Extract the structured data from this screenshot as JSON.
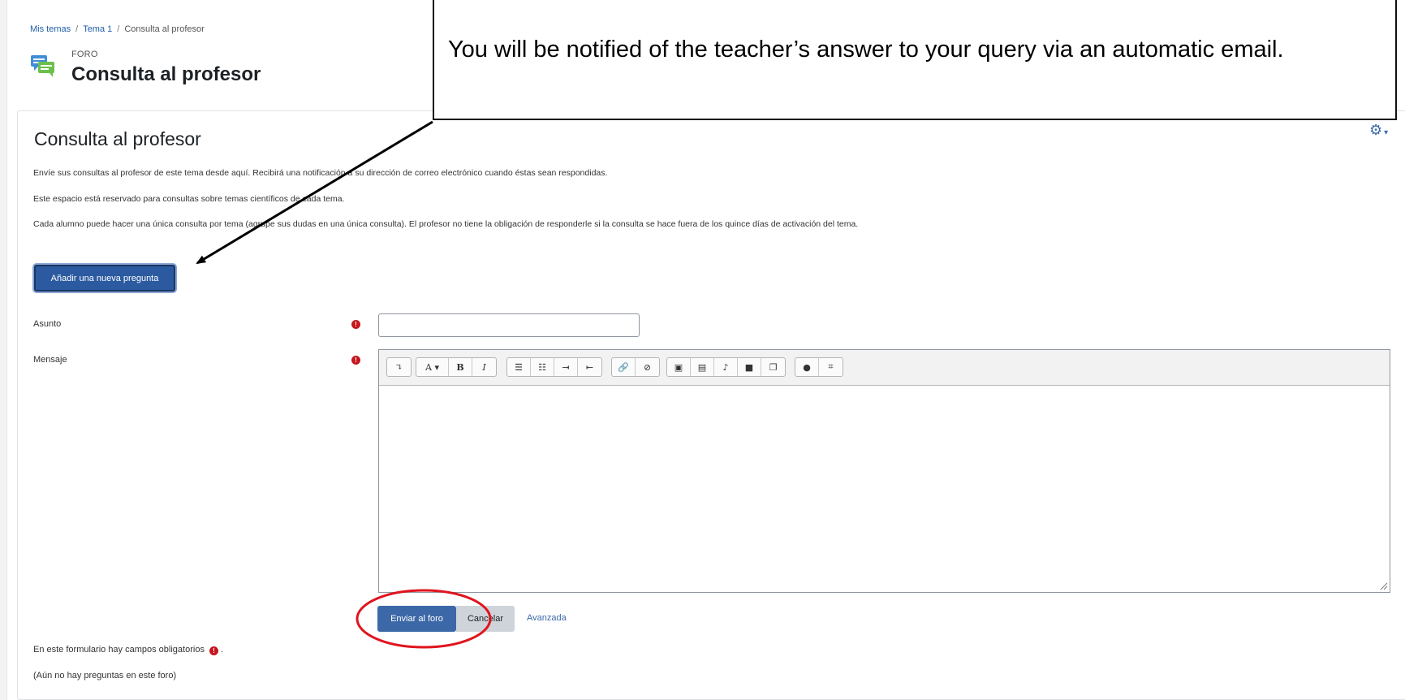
{
  "breadcrumb": {
    "items": [
      "Mis temas",
      "Tema 1",
      "Consulta al profesor"
    ],
    "separator": "/"
  },
  "header": {
    "module_type": "FORO",
    "title": "Consulta al profesor",
    "icon": "forum-icon"
  },
  "main": {
    "section_title": "Consulta al profesor",
    "intro": [
      "Envíe sus consultas al profesor de este tema desde aquí. Recibirá una notificación a su dirección de correo electrónico cuando éstas sean respondidas.",
      "Este espacio está reservado para consultas sobre temas científicos de cada tema.",
      "Cada alumno puede hacer una única consulta por tema (agrupe sus dudas en una única consulta). El profesor no tiene la obligación de responderle si la consulta se hace fuera de los quince días de activación del tema."
    ],
    "add_button": "Añadir una nueva pregunta",
    "settings_icon": "gear-icon"
  },
  "form": {
    "subject_label": "Asunto",
    "subject_value": "",
    "message_label": "Mensaje",
    "message_value": "",
    "required_icon": "!",
    "submit": "Enviar al foro",
    "cancel": "Cancelar",
    "advanced": "Avanzada",
    "required_note": "En este formulario hay campos obligatorios",
    "required_note_suffix": ".",
    "empty_note": "(Aún no hay preguntas en este foro)"
  },
  "editor_toolbar": {
    "groups": [
      [
        "expand-icon"
      ],
      [
        "font-size-icon",
        "bold-icon",
        "italic-icon"
      ],
      [
        "unordered-list-icon",
        "ordered-list-icon",
        "indent-icon",
        "outdent-icon"
      ],
      [
        "link-icon",
        "unlink-icon"
      ],
      [
        "image-icon",
        "media-icon",
        "record-audio-icon",
        "record-video-icon",
        "manage-files-icon"
      ],
      [
        "accessibility-icon",
        "html-icon"
      ]
    ],
    "labels": {
      "font_size": "A",
      "bold": "B",
      "italic": "I"
    }
  },
  "annotation": {
    "text": "You will be notified of the teacher’s answer to your query via an automatic email.",
    "highlight_color": "#e0141e",
    "arrow_color": "#000000"
  },
  "colors": {
    "primary": "#3c68a8",
    "required": "#c4161c",
    "link": "#1f5ea8"
  }
}
